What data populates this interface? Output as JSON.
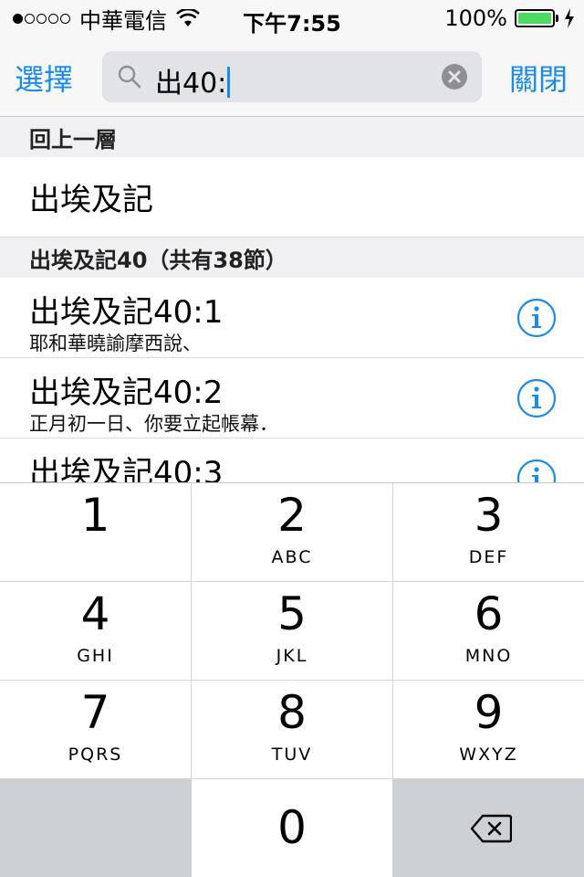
{
  "status_bar": {
    "carrier": "中華電信",
    "time": "下午7:55",
    "battery_percent": "100%",
    "signal_bars_filled": 1,
    "signal_bars_total": 5
  },
  "search": {
    "select_label": "選擇",
    "query": "出40:",
    "close_label": "關閉"
  },
  "list": {
    "up_header": "回上一層",
    "parent_item": "出埃及記",
    "chapter_header": "出埃及記40（共有38節）",
    "verses": [
      {
        "title": "出埃及記40:1",
        "snippet": "耶和華曉諭摩西說、"
      },
      {
        "title": "出埃及記40:2",
        "snippet": "正月初一日、你要立起帳幕．"
      },
      {
        "title": "出埃及記40:3",
        "snippet": ""
      }
    ]
  },
  "keypad": {
    "keys": [
      {
        "num": "1",
        "letters": ""
      },
      {
        "num": "2",
        "letters": "ABC"
      },
      {
        "num": "3",
        "letters": "DEF"
      },
      {
        "num": "4",
        "letters": "GHI"
      },
      {
        "num": "5",
        "letters": "JKL"
      },
      {
        "num": "6",
        "letters": "MNO"
      },
      {
        "num": "7",
        "letters": "PQRS"
      },
      {
        "num": "8",
        "letters": "TUV"
      },
      {
        "num": "9",
        "letters": "WXYZ"
      }
    ],
    "zero": "0"
  },
  "colors": {
    "accent": "#1a8ce8",
    "battery": "#4cd964",
    "dark_key": "#cdd0d5"
  }
}
